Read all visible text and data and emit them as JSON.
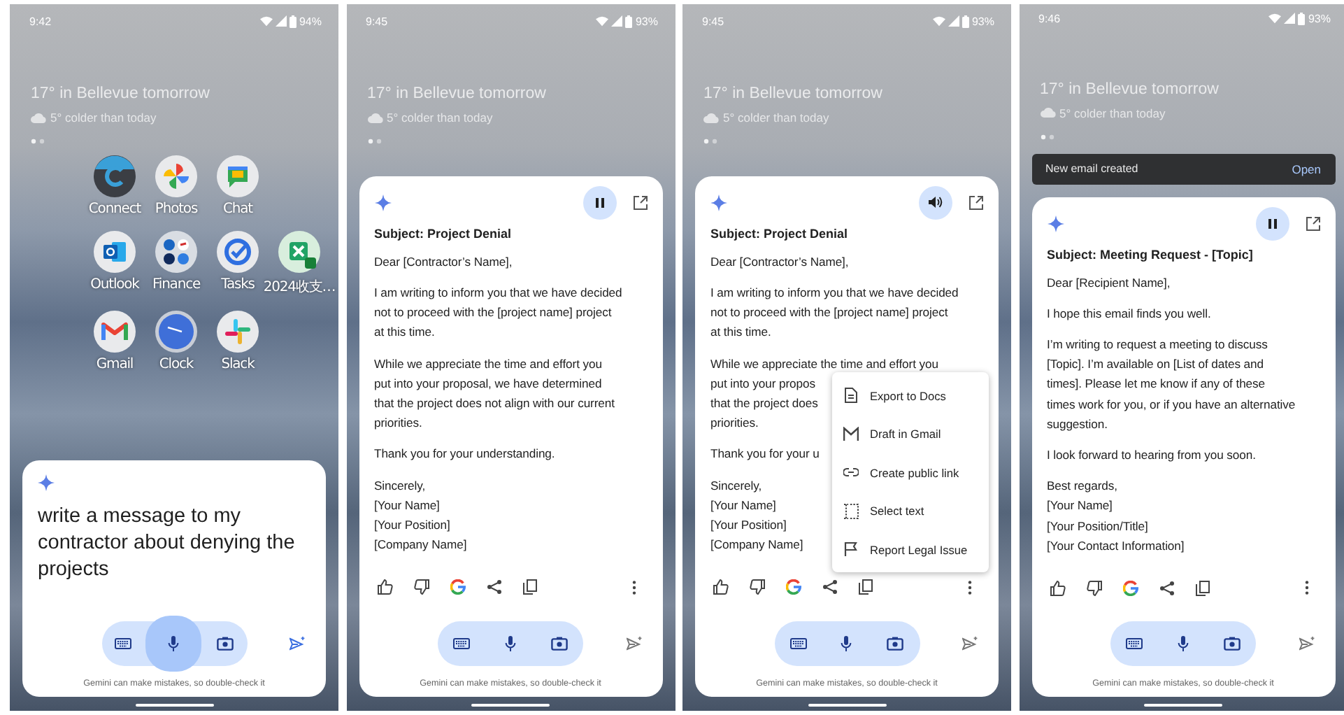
{
  "screens": [
    {
      "kind": "home",
      "time": "9:42",
      "battery": "94%",
      "weather": {
        "headline": "17° in Bellevue tomorrow",
        "detail": "5° colder than today"
      },
      "app_rows": [
        [
          {
            "label": "Connect"
          },
          {
            "label": "Photos"
          },
          {
            "label": "Chat"
          }
        ],
        [
          {
            "label": "Outlook"
          },
          {
            "label": "Finance"
          },
          {
            "label": "Tasks"
          },
          {
            "label": "2024收支…"
          }
        ],
        [
          {
            "label": "Gmail"
          },
          {
            "label": "Clock"
          },
          {
            "label": "Slack"
          }
        ]
      ],
      "prompt": "write a message to my contractor about denying the projects",
      "listening": true,
      "disclaimer": "Gemini can make mistakes, so double-check it"
    },
    {
      "kind": "response",
      "time": "9:45",
      "battery": "93%",
      "weather": {
        "headline": "17° in Bellevue tomorrow",
        "detail": "5° colder than today"
      },
      "playing": true,
      "subject": "Subject: Project Denial",
      "paragraphs": [
        [
          "Dear [Contractor’s Name],"
        ],
        [
          "I am writing to inform you that we have decided",
          "not to proceed with the [project name] project",
          "at this time."
        ],
        [
          "While we appreciate the time and effort you",
          "put into your proposal, we have determined",
          "that the project does not align with our current",
          "priorities."
        ],
        [
          "Thank you for your understanding."
        ],
        [
          "Sincerely,",
          "[Your Name]",
          "[Your Position]",
          "[Company Name]"
        ]
      ],
      "listening": false,
      "disclaimer": "Gemini can make mistakes, so double-check it"
    },
    {
      "kind": "response",
      "time": "9:45",
      "battery": "93%",
      "weather": {
        "headline": "17° in Bellevue tomorrow",
        "detail": "5° colder than today"
      },
      "playing": false,
      "subject": "Subject: Project Denial",
      "paragraphs": [
        [
          "Dear [Contractor’s Name],"
        ],
        [
          "I am writing to inform you that we have decided",
          "not to proceed with the [project name] project",
          "at this time."
        ],
        [
          "While we appreciate the time and effort you",
          "put into your propos",
          "that the project does",
          "priorities."
        ],
        [
          "Thank you for your u"
        ],
        [
          "Sincerely,",
          "[Your Name]",
          "[Your Position]",
          "[Company Name]"
        ]
      ],
      "menu": [
        {
          "label": "Export to Docs"
        },
        {
          "label": "Draft in Gmail"
        },
        {
          "label": "Create public link"
        },
        {
          "label": "Select text"
        },
        {
          "label": "Report Legal Issue"
        }
      ],
      "listening": false,
      "disclaimer": "Gemini can make mistakes, so double-check it"
    },
    {
      "kind": "response",
      "time": "9:46",
      "battery": "93%",
      "weather": {
        "headline": "17° in Bellevue tomorrow",
        "detail": "5° colder than today"
      },
      "snackbar": {
        "text": "New email created",
        "action": "Open"
      },
      "playing": true,
      "subject": "Subject: Meeting Request - [Topic]",
      "paragraphs": [
        [
          "Dear [Recipient Name],"
        ],
        [
          "I hope this email finds you well."
        ],
        [
          "I’m writing to request a meeting to discuss",
          "[Topic]. I’m available on [List of dates and",
          "times]. Please let me know if any of these",
          "times work for you, or if you have an alternative",
          "suggestion."
        ],
        [
          "I look forward to hearing from you soon."
        ],
        [
          "Best regards,",
          "[Your Name]",
          "[Your Position/Title]",
          "[Your Contact Information]"
        ]
      ],
      "listening": false,
      "disclaimer": "Gemini can make mistakes, so double-check it"
    }
  ]
}
